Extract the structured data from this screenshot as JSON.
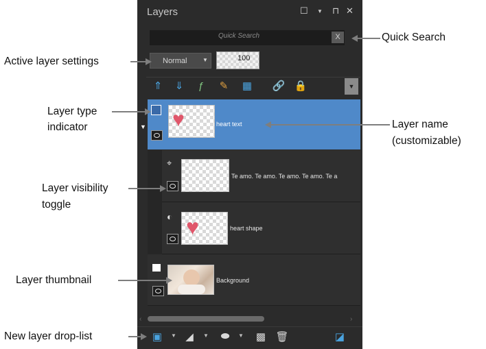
{
  "panel": {
    "title": "Layers",
    "quick_search_placeholder": "Quick Search",
    "quick_search_clear": "X",
    "blend_mode": "Normal",
    "opacity": "100",
    "layers": [
      {
        "name": "heart text",
        "type": "text",
        "visible": true,
        "selected": true
      },
      {
        "name": "Te amo. Te amo. Te amo. Te amo. Te a",
        "type": "vector",
        "visible": true
      },
      {
        "name": "heart shape",
        "type": "vector-shape",
        "visible": true
      },
      {
        "name": "Background",
        "type": "raster",
        "visible": true
      }
    ]
  },
  "callouts": {
    "quick_search": "Quick Search",
    "active_layer_settings": "Active layer settings",
    "layer_type_indicator_1": "Layer type",
    "layer_type_indicator_2": "indicator",
    "layer_name_1": "Layer name",
    "layer_name_2": "(customizable)",
    "layer_visibility_1": "Layer visibility",
    "layer_visibility_2": "toggle",
    "layer_thumbnail": "Layer thumbnail",
    "new_layer_droplist": "New layer drop-list"
  },
  "colors": {
    "panel_bg": "#2b2b2b",
    "selected_row": "#4f89c9",
    "accent_icon": "#4aa3df",
    "heart": "#e0566a"
  }
}
